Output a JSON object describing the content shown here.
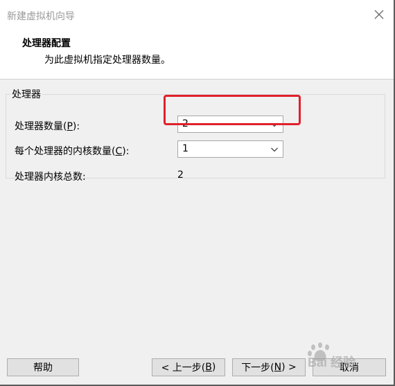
{
  "window": {
    "title": "新建虚拟机向导"
  },
  "header": {
    "title": "处理器配置",
    "subtitle": "为此虚拟机指定处理器数量。"
  },
  "processor_group": {
    "legend": "处理器",
    "processor_count": {
      "label_prefix": "处理器数量(",
      "mnemonic": "P",
      "label_suffix": "):",
      "value": "2"
    },
    "cores_per_processor": {
      "label_prefix": "每个处理器的内核数量(",
      "mnemonic": "C",
      "label_suffix": "):",
      "value": "1"
    },
    "total_cores": {
      "label": "处理器内核总数:",
      "value": "2"
    }
  },
  "buttons": {
    "help": {
      "label": "帮助"
    },
    "back": {
      "prefix": "< 上一步(",
      "mnemonic": "B",
      "suffix": ")"
    },
    "next": {
      "prefix": "下一步(",
      "mnemonic": "N",
      "suffix": ") >"
    },
    "cancel": {
      "label": "取消"
    }
  },
  "watermark": {
    "text": "Bai 经验"
  },
  "colors": {
    "highlight_border": "#e0202a",
    "dialog_bg": "#f0f0f0",
    "title_text": "#9a9a9a"
  }
}
